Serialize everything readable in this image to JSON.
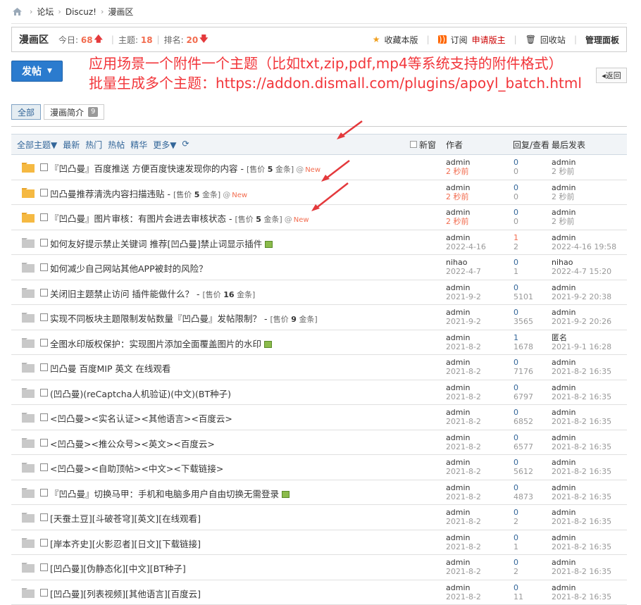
{
  "breadcrumb": [
    "论坛",
    "Discuz!",
    "漫画区"
  ],
  "forum": {
    "name": "漫画区",
    "today_label": "今日:",
    "today_value": "68",
    "threads_label": "主题:",
    "threads_value": "18",
    "rank_label": "排名:",
    "rank_value": "20",
    "actions": {
      "favorite": "收藏本版",
      "subscribe": "订阅",
      "apply": "申请版主",
      "recycle": "回收站",
      "manage": "管理面板"
    }
  },
  "post_button": "发帖",
  "promo": {
    "line1": "应用场景一个附件一个主题（比如txt,zip,pdf,mp4等系统支持的附件格式）",
    "line2": "批量生成多个主题：https://addon.dismall.com/plugins/apoyl_batch.html"
  },
  "back_label": "返回",
  "tabs": [
    {
      "label": "全部"
    },
    {
      "label": "漫画简介",
      "count": "9"
    }
  ],
  "list_header": {
    "filters": [
      "全部主题▼",
      "最新",
      "热门",
      "热帖",
      "精华",
      "更多▼",
      "⟳"
    ],
    "newwin": "新窗",
    "author": "作者",
    "reply": "回复/查看",
    "last": "最后发表"
  },
  "rows": [
    {
      "title": "『凹凸曼』百度推送 方便百度快速发现你的内容",
      "price": "5",
      "clip": true,
      "new": "New",
      "author": "admin",
      "date": "2 秒前",
      "date_red": true,
      "replies": "0",
      "views": "0",
      "last_user": "admin",
      "last_time": "2 秒前",
      "folder": "gold"
    },
    {
      "title": "凹凸曼推荐清洗内容扫描违贴",
      "price": "5",
      "clip": true,
      "new": "New",
      "author": "admin",
      "date": "2 秒前",
      "date_red": true,
      "replies": "0",
      "views": "0",
      "last_user": "admin",
      "last_time": "2 秒前",
      "folder": "gold"
    },
    {
      "title": "『凹凸曼』图片审核：有图片会进去审核状态",
      "price": "5",
      "clip": true,
      "new": "New",
      "author": "admin",
      "date": "2 秒前",
      "date_red": true,
      "replies": "0",
      "views": "0",
      "last_user": "admin",
      "last_time": "2 秒前",
      "folder": "gold"
    },
    {
      "title": "如何友好提示禁止关键词 推荐[凹凸曼]禁止词显示插件",
      "img": true,
      "author": "admin",
      "date": "2022-4-16",
      "replies": "1",
      "views": "2",
      "replies_red": true,
      "last_user": "admin",
      "last_time": "2022-4-16 19:58"
    },
    {
      "title": "如何减少自己网站其他APP被封的风险？",
      "author": "nihao",
      "date": "2022-4-7",
      "replies": "0",
      "views": "1",
      "last_user": "nihao",
      "last_time": "2022-4-7 15:20"
    },
    {
      "title": "关闭旧主题禁止访问 插件能做什么？",
      "price": "16",
      "author": "admin",
      "date": "2021-9-2",
      "replies": "0",
      "views": "5101",
      "last_user": "admin",
      "last_time": "2021-9-2 20:38"
    },
    {
      "title": "实现不同板块主题限制发帖数量『凹凸曼』发帖限制？",
      "price": "9",
      "author": "admin",
      "date": "2021-9-2",
      "replies": "0",
      "views": "3565",
      "last_user": "admin",
      "last_time": "2021-9-2 20:26"
    },
    {
      "title": "全图水印版权保护：实现图片添加全面覆盖图片的水印",
      "img": true,
      "author": "admin",
      "date": "2021-8-2",
      "replies": "1",
      "views": "1678",
      "last_user": "匿名",
      "last_time": "2021-9-1 16:28"
    },
    {
      "title": "凹凸曼 百度MIP 英文 在线观看",
      "author": "admin",
      "date": "2021-8-2",
      "replies": "0",
      "views": "7176",
      "last_user": "admin",
      "last_time": "2021-8-2 16:35"
    },
    {
      "title": "(凹凸曼)(reCaptcha人机验证)(中文)(BT种子)",
      "author": "admin",
      "date": "2021-8-2",
      "replies": "0",
      "views": "6797",
      "last_user": "admin",
      "last_time": "2021-8-2 16:35"
    },
    {
      "title": "<凹凸曼><实名认证><其他语言><百度云>",
      "author": "admin",
      "date": "2021-8-2",
      "replies": "0",
      "views": "6852",
      "last_user": "admin",
      "last_time": "2021-8-2 16:35"
    },
    {
      "title": "<凹凸曼><推公众号><英文><百度云>",
      "author": "admin",
      "date": "2021-8-2",
      "replies": "0",
      "views": "6577",
      "last_user": "admin",
      "last_time": "2021-8-2 16:35"
    },
    {
      "title": "<凹凸曼><自助顶帖><中文><下载链接>",
      "author": "admin",
      "date": "2021-8-2",
      "replies": "0",
      "views": "5612",
      "last_user": "admin",
      "last_time": "2021-8-2 16:35"
    },
    {
      "title": "『凹凸曼』切换马甲：手机和电脑多用户自由切换无需登录",
      "img": true,
      "author": "admin",
      "date": "2021-8-2",
      "replies": "0",
      "views": "4873",
      "last_user": "admin",
      "last_time": "2021-8-2 16:35"
    },
    {
      "title": "[天蚕土豆][斗破苍穹][英文][在线观看]",
      "author": "admin",
      "date": "2021-8-2",
      "replies": "0",
      "views": "2",
      "last_user": "admin",
      "last_time": "2021-8-2 16:35"
    },
    {
      "title": "[岸本齐史][火影忍者][日文][下载链接]",
      "author": "admin",
      "date": "2021-8-2",
      "replies": "0",
      "views": "1",
      "last_user": "admin",
      "last_time": "2021-8-2 16:35"
    },
    {
      "title": "[凹凸曼][伪静态化][中文][BT种子]",
      "author": "admin",
      "date": "2021-8-2",
      "replies": "0",
      "views": "2",
      "last_user": "admin",
      "last_time": "2021-8-2 16:35"
    },
    {
      "title": "[凹凸曼][列表视频][其他语言][百度云]",
      "author": "admin",
      "date": "2021-8-2",
      "replies": "0",
      "views": "11",
      "last_user": "admin",
      "last_time": "2021-8-2 16:35"
    }
  ],
  "price_prefix": "[售价",
  "price_suffix": "金条]",
  "colors": {
    "accent": "#2b7bce",
    "promo": "#f2353a",
    "new": "#f26c4f",
    "link": "#336699"
  }
}
